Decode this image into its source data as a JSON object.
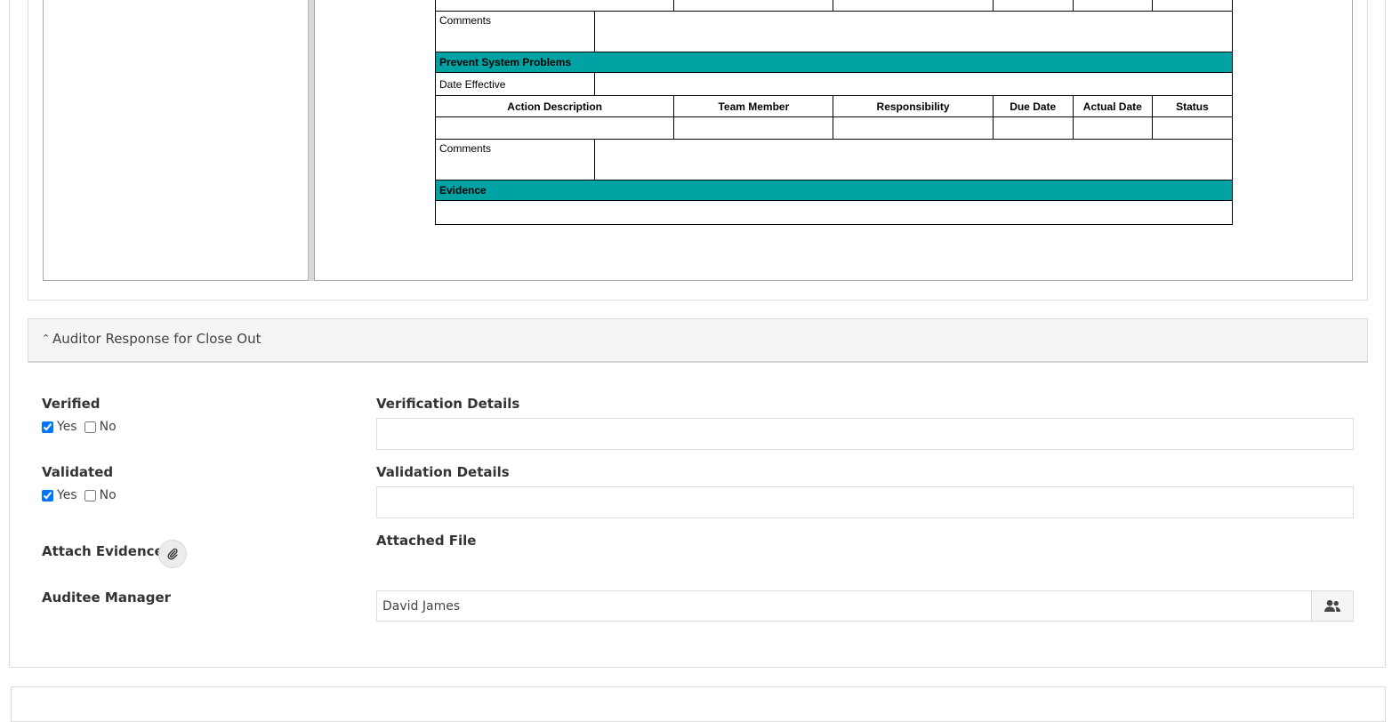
{
  "document": {
    "comments_label": "Comments",
    "prevent_section": "Prevent System Problems",
    "date_effective_label": "Date Effective",
    "columns": [
      "Action Description",
      "Team Member",
      "Responsibility",
      "Due Date",
      "Actual Date",
      "Status"
    ],
    "comments_label_2": "Comments",
    "evidence_section": "Evidence",
    "section_color": "#00a3a3"
  },
  "auditor_response": {
    "title": "Auditor Response for Close Out",
    "verified": {
      "label": "Verified",
      "yes": "Yes",
      "no": "No",
      "value": "Yes"
    },
    "verification_details": {
      "label": "Verification Details",
      "value": ""
    },
    "validated": {
      "label": "Validated",
      "yes": "Yes",
      "no": "No",
      "value": "Yes"
    },
    "validation_details": {
      "label": "Validation Details",
      "value": ""
    },
    "attach_evidence": {
      "label": "Attach Evidence",
      "icon": "paperclip-icon"
    },
    "attached_file": {
      "label": "Attached File"
    },
    "auditee_manager": {
      "label": "Auditee Manager",
      "value": "David James",
      "icon": "people-icon"
    }
  }
}
